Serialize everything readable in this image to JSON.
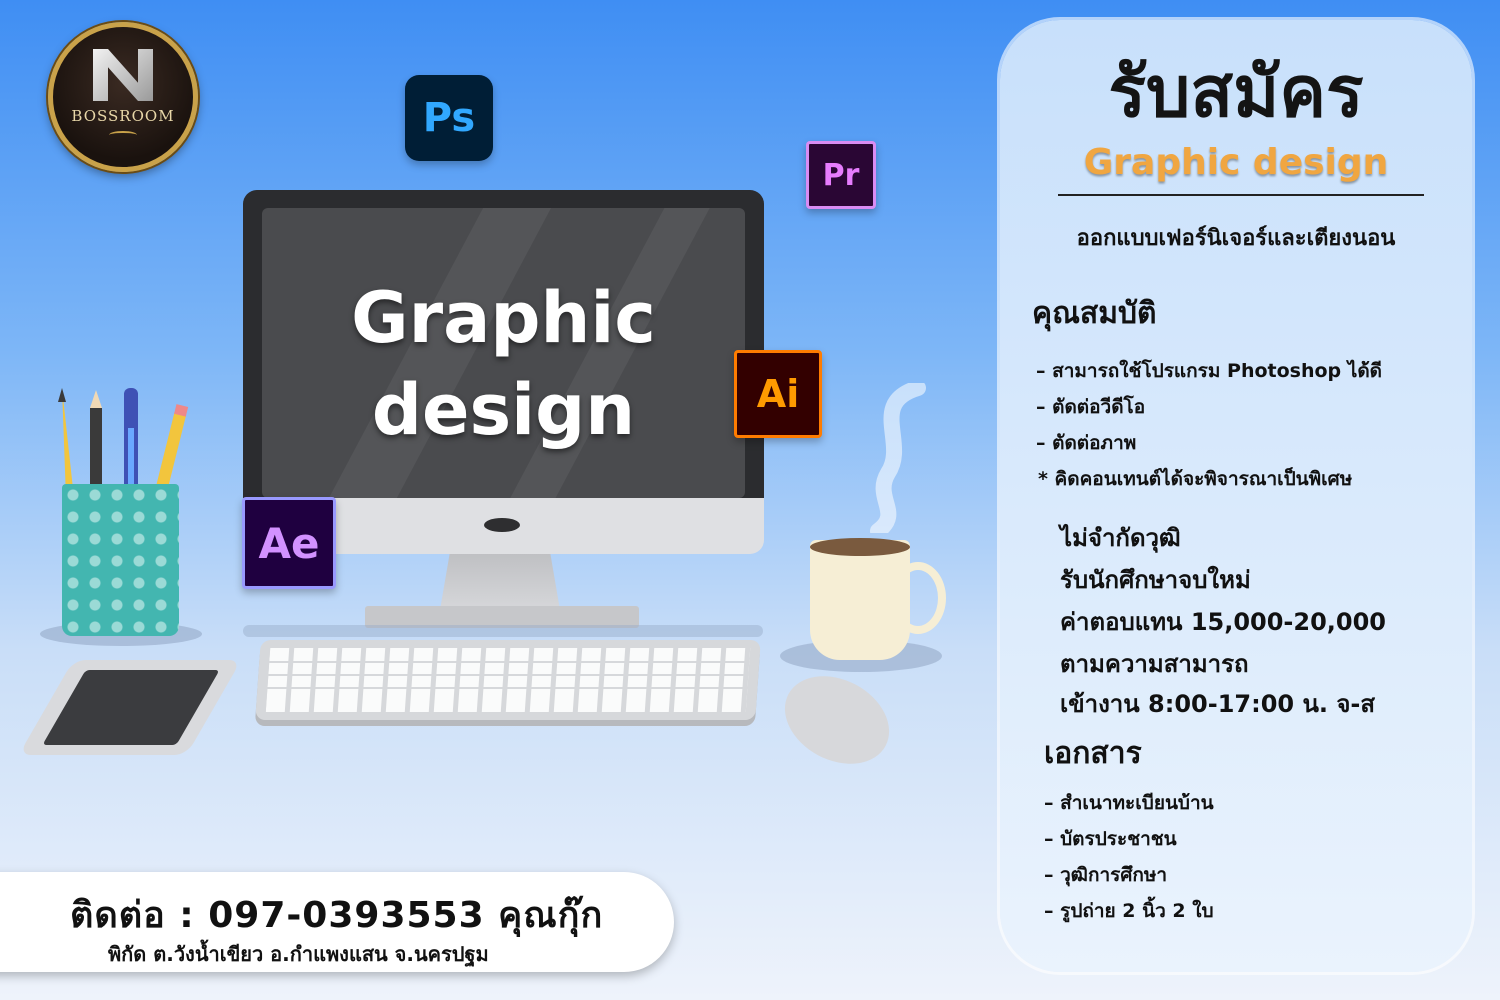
{
  "logo": {
    "text": "BOSSROOM"
  },
  "app_icons": {
    "ps": "Ps",
    "pr": "Pr",
    "ai": "Ai",
    "ae": "Ae"
  },
  "screen": {
    "line1": "Graphic",
    "line2": "design"
  },
  "card": {
    "headline": "รับสมัคร",
    "subheadline": "Graphic design",
    "company": "ออกแบบเฟอร์นิเจอร์และเตียงนอน",
    "qualifications_title": "คุณสมบัติ",
    "qualifications": [
      "– สามารถใช้โปรแกรม Photoshop ได้ดี",
      "– ตัดต่อวีดีโอ",
      "– ตัดต่อภาพ",
      "*  คิดคอนเทนต์ได้จะพิจารณาเป็นพิเศษ"
    ],
    "details": [
      "ไม่จำกัดวุฒิ",
      "รับนักศึกษาจบใหม่",
      "ค่าตอบแทน 15,000-20,000",
      "ตามความสามารถ",
      "เข้างาน 8:00-17:00 น.  จ-ส"
    ],
    "documents_title": "เอกสาร",
    "documents": [
      "– สำเนาทะเบียนบ้าน",
      "– บัตรประชาชน",
      "– วุฒิการศึกษา",
      "– รูปถ่าย 2 นิ้ว 2 ใบ"
    ]
  },
  "contact": {
    "line1": "ติดต่อ :  097-0393553  คุณกุ๊ก",
    "line2": "พิกัด ต.วังน้ำเขียว อ.กำแพงแสน จ.นครปฐม"
  },
  "colors": {
    "accent": "#f0a641",
    "background_top": "#3f8ef3",
    "card": "#dbeafc"
  }
}
